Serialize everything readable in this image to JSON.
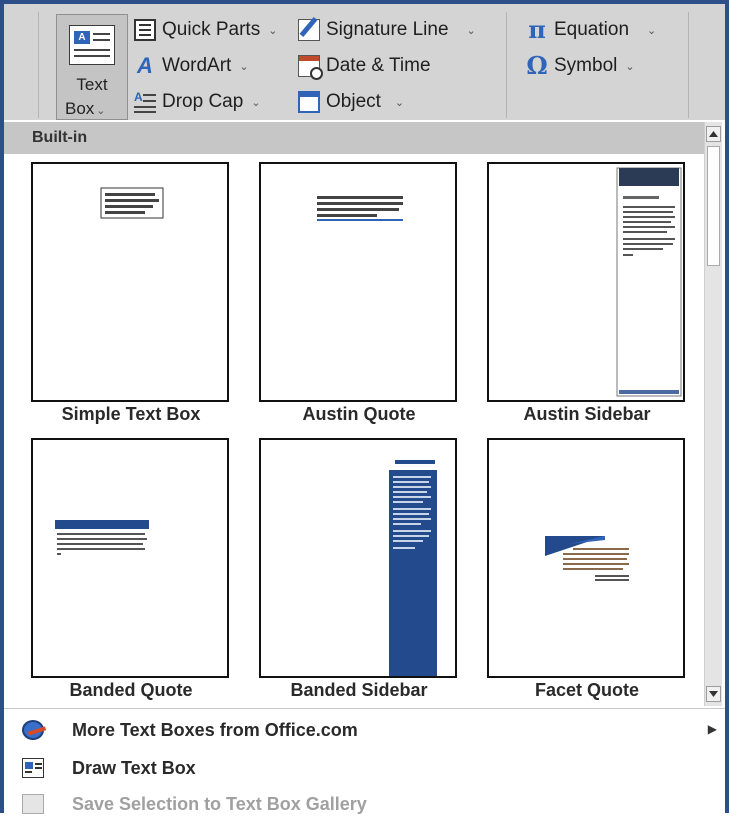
{
  "ribbon": {
    "text_box": {
      "label_line1": "Text",
      "label_line2": "Box"
    },
    "quick_parts": "Quick Parts",
    "wordart": "WordArt",
    "drop_cap": "Drop Cap",
    "signature_line": "Signature Line",
    "date_time": "Date & Time",
    "object": "Object",
    "equation": "Equation",
    "symbol": "Symbol",
    "icons": {
      "quick_parts": "quick-parts-icon",
      "wordart": "wordart-icon",
      "drop_cap": "drop-cap-icon",
      "signature_line": "signature-line-icon",
      "date_time": "date-time-icon",
      "object": "object-icon",
      "equation": "pi-icon",
      "symbol": "omega-icon"
    }
  },
  "gallery": {
    "section_header": "Built-in",
    "items": [
      {
        "name": "Simple Text Box"
      },
      {
        "name": "Austin Quote"
      },
      {
        "name": "Austin Sidebar"
      },
      {
        "name": "Banded Quote"
      },
      {
        "name": "Banded Sidebar"
      },
      {
        "name": "Facet Quote"
      }
    ]
  },
  "menu": {
    "more_text_boxes": "More Text Boxes from Office.com",
    "draw_text_box": "Draw Text Box",
    "save_selection": "Save Selection to Text Box Gallery"
  },
  "colors": {
    "frame_border": "#2b4f86",
    "ribbon_bg": "#d4d4d4",
    "accent_blue": "#2f64b8",
    "banded_blue": "#234a8c"
  }
}
